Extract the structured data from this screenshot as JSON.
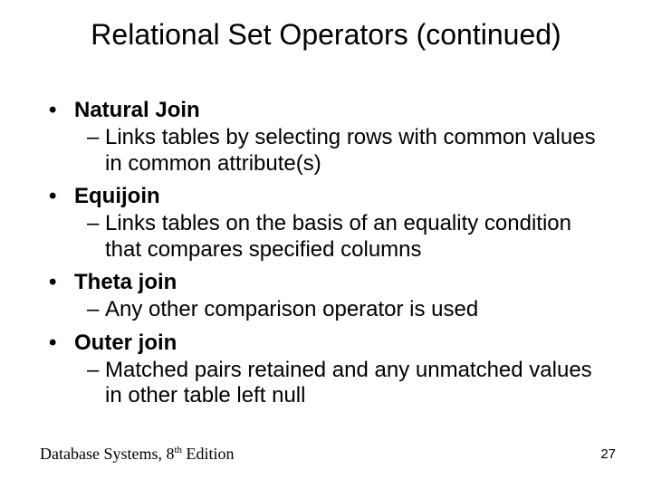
{
  "title": "Relational Set Operators (continued)",
  "items": [
    {
      "label": "Natural Join",
      "sub": "Links tables by selecting rows with common values in common attribute(s)"
    },
    {
      "label": "Equijoin",
      "sub": "Links tables on the basis of an equality condition that compares specified columns"
    },
    {
      "label": "Theta join",
      "sub": "Any other comparison operator is used"
    },
    {
      "label": "Outer join",
      "sub": "Matched pairs retained and any unmatched values in other table left null"
    }
  ],
  "footer": {
    "book": "Database Systems, 8",
    "ord": "th",
    "edition_word": " Edition",
    "page": "27"
  }
}
